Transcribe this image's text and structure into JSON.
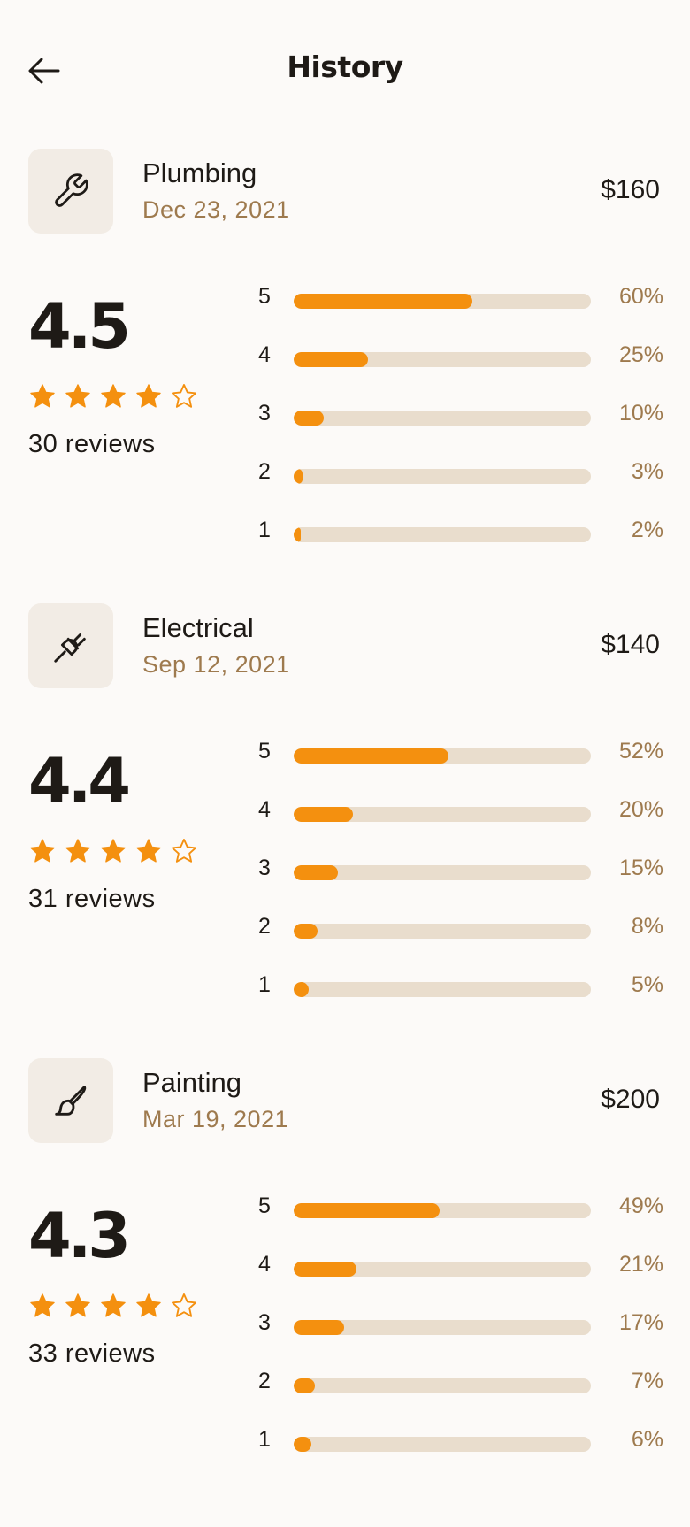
{
  "header": {
    "title": "History",
    "back_icon": "arrow-left-icon"
  },
  "colors": {
    "accent": "#F4900F",
    "track": "#E9DDCD",
    "muted_text": "#9E7A4E",
    "icon_bg": "#F2ECE5",
    "background": "#FCFAF8"
  },
  "history": [
    {
      "service": "Plumbing",
      "icon": "wrench-icon",
      "date": "Dec 23, 2021",
      "price": "$160",
      "rating": "4.5",
      "stars_filled": 4,
      "stars_total": 5,
      "reviews": "30 reviews",
      "distribution": [
        {
          "label": "5",
          "percent": 60,
          "text": "60%"
        },
        {
          "label": "4",
          "percent": 25,
          "text": "25%"
        },
        {
          "label": "3",
          "percent": 10,
          "text": "10%"
        },
        {
          "label": "2",
          "percent": 3,
          "text": "3%"
        },
        {
          "label": "1",
          "percent": 2,
          "text": "2%"
        }
      ]
    },
    {
      "service": "Electrical",
      "icon": "plug-icon",
      "date": "Sep 12, 2021",
      "price": "$140",
      "rating": "4.4",
      "stars_filled": 4,
      "stars_total": 5,
      "reviews": "31 reviews",
      "distribution": [
        {
          "label": "5",
          "percent": 52,
          "text": "52%"
        },
        {
          "label": "4",
          "percent": 20,
          "text": "20%"
        },
        {
          "label": "3",
          "percent": 15,
          "text": "15%"
        },
        {
          "label": "2",
          "percent": 8,
          "text": "8%"
        },
        {
          "label": "1",
          "percent": 5,
          "text": "5%"
        }
      ]
    },
    {
      "service": "Painting",
      "icon": "paintbrush-icon",
      "date": "Mar 19, 2021",
      "price": "$200",
      "rating": "4.3",
      "stars_filled": 4,
      "stars_total": 5,
      "reviews": "33 reviews",
      "distribution": [
        {
          "label": "5",
          "percent": 49,
          "text": "49%"
        },
        {
          "label": "4",
          "percent": 21,
          "text": "21%"
        },
        {
          "label": "3",
          "percent": 17,
          "text": "17%"
        },
        {
          "label": "2",
          "percent": 7,
          "text": "7%"
        },
        {
          "label": "1",
          "percent": 6,
          "text": "6%"
        }
      ]
    }
  ]
}
